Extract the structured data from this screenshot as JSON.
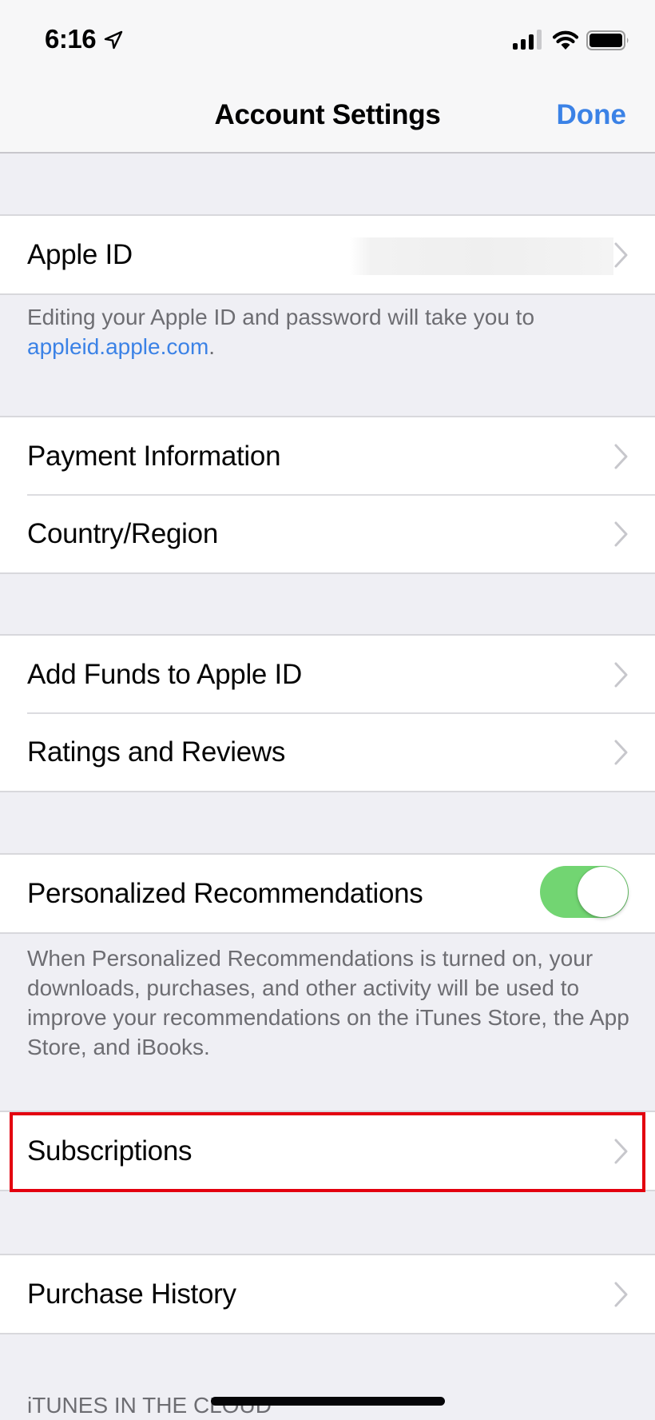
{
  "status_bar": {
    "time": "6:16",
    "icons": [
      "location-arrow-icon",
      "cellular-signal-icon",
      "wifi-icon",
      "battery-icon"
    ]
  },
  "nav": {
    "title": "Account Settings",
    "done_label": "Done"
  },
  "colors": {
    "accent": "#3b82e6",
    "toggle_on": "#72d572",
    "highlight": "#e3000f",
    "background": "#efeff4",
    "footer_text": "#6d6d72",
    "chevron": "#c7c7cc"
  },
  "sections": {
    "apple_id": {
      "label": "Apple ID",
      "value_redacted": true,
      "footer_text": "Editing your Apple ID and password will take you to ",
      "footer_link": "appleid.apple.com",
      "footer_end": "."
    },
    "payment": {
      "rows": [
        {
          "label": "Payment Information"
        },
        {
          "label": "Country/Region"
        }
      ]
    },
    "funds": {
      "rows": [
        {
          "label": "Add Funds to Apple ID"
        },
        {
          "label": "Ratings and Reviews"
        }
      ]
    },
    "recommendations": {
      "label": "Personalized Recommendations",
      "toggle_on": true,
      "footer_text": "When Personalized Recommendations is turned on, your downloads, purchases, and other activity will be used to improve your recommendations on the iTunes Store, the App Store, and iBooks."
    },
    "subscriptions": {
      "label": "Subscriptions",
      "highlighted": true
    },
    "purchase_history": {
      "label": "Purchase History"
    },
    "itunes_cloud_header": "iTUNES IN THE CLOUD"
  }
}
